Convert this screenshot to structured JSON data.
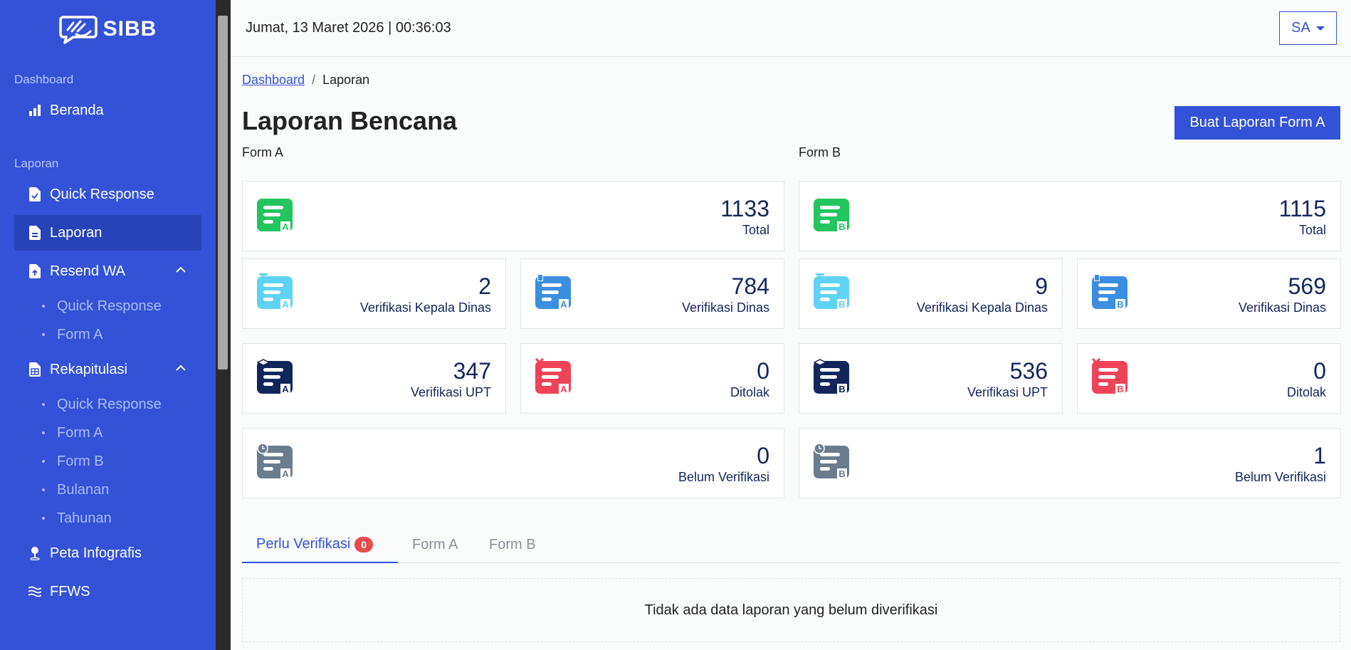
{
  "brand": {
    "name": "SIBB"
  },
  "sidebar": {
    "sections": [
      {
        "title": "Dashboard"
      },
      {
        "title": "Laporan"
      }
    ],
    "items": {
      "beranda": "Beranda",
      "quick_response": "Quick Response",
      "laporan": "Laporan",
      "resend_wa": "Resend WA",
      "rekapitulasi": "Rekapitulasi",
      "peta_infografis": "Peta Infografis",
      "ffws": "FFWS"
    },
    "resend_sub": [
      "Quick Response",
      "Form A"
    ],
    "rekap_sub": [
      "Quick Response",
      "Form A",
      "Form B",
      "Bulanan",
      "Tahunan"
    ],
    "active_item": "Laporan"
  },
  "topbar": {
    "datetime": "Jumat, 13 Maret 2026 | 00:36:03",
    "user_initials": "SA"
  },
  "breadcrumb": {
    "home": "Dashboard",
    "sep": "/",
    "current": "Laporan"
  },
  "page": {
    "title": "Laporan Bencana",
    "create_button": "Buat Laporan Form A"
  },
  "form_a": {
    "label": "Form A",
    "total": {
      "value": "1133",
      "label": "Total"
    },
    "kepala_dinas": {
      "value": "2",
      "label": "Verifikasi Kepala Dinas"
    },
    "dinas": {
      "value": "784",
      "label": "Verifikasi Dinas"
    },
    "upt": {
      "value": "347",
      "label": "Verifikasi UPT"
    },
    "ditolak": {
      "value": "0",
      "label": "Ditolak"
    },
    "belum": {
      "value": "0",
      "label": "Belum Verifikasi"
    },
    "icon_letter": "A"
  },
  "form_b": {
    "label": "Form B",
    "total": {
      "value": "1115",
      "label": "Total"
    },
    "kepala_dinas": {
      "value": "9",
      "label": "Verifikasi Kepala Dinas"
    },
    "dinas": {
      "value": "569",
      "label": "Verifikasi Dinas"
    },
    "upt": {
      "value": "536",
      "label": "Verifikasi UPT"
    },
    "ditolak": {
      "value": "0",
      "label": "Ditolak"
    },
    "belum": {
      "value": "1",
      "label": "Belum Verifikasi"
    },
    "icon_letter": "B"
  },
  "tabs": {
    "perlu": "Perlu Verifikasi",
    "perlu_count": "0",
    "form_a": "Form A",
    "form_b": "Form B"
  },
  "empty_message": "Tidak ada data laporan yang belum diverifikasi",
  "colors": {
    "primary": "#3352d7",
    "total": "#22c55e",
    "kepala_dinas": "#5fd3f3",
    "dinas": "#3b8fe0",
    "upt": "#13265c",
    "ditolak": "#ef4458",
    "belum": "#6b7c8c"
  }
}
